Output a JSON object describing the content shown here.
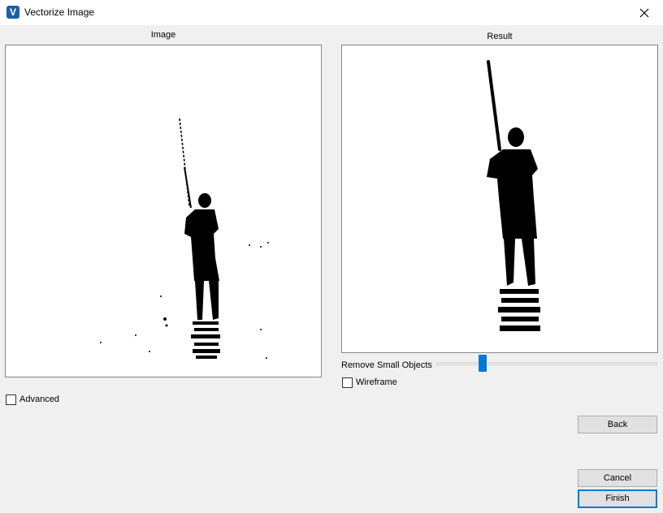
{
  "window": {
    "title": "Vectorize Image",
    "icon_letter": "V"
  },
  "panels": {
    "image_label": "Image",
    "result_label": "Result"
  },
  "controls": {
    "remove_small_objects_label": "Remove Small Objects",
    "remove_small_objects_value": 0.21,
    "wireframe_label": "Wireframe",
    "wireframe_checked": false,
    "advanced_label": "Advanced",
    "advanced_checked": false
  },
  "buttons": {
    "back": "Back",
    "cancel": "Cancel",
    "finish": "Finish"
  },
  "colors": {
    "accent": "#0078d7",
    "panel_border": "#828790",
    "window_bg": "#f0f0f0"
  }
}
